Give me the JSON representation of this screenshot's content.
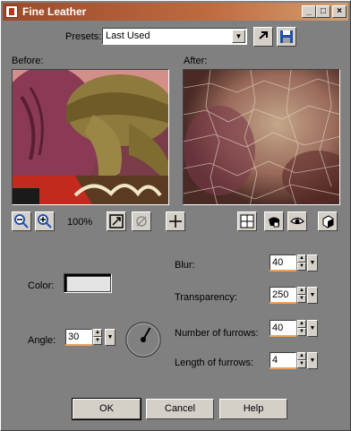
{
  "window": {
    "title": "Fine Leather",
    "minimize_glyph": "_",
    "maximize_glyph": "□",
    "close_glyph": "×"
  },
  "presets": {
    "label": "Presets:",
    "value": "Last Used"
  },
  "preview": {
    "before_label": "Before:",
    "after_label": "After:",
    "zoom_level": "100%"
  },
  "settings": {
    "color_label": "Color:",
    "color_value": "#e4e4e4",
    "angle_label": "Angle:",
    "angle_value": "30",
    "blur_label": "Blur:",
    "blur_value": "40",
    "transparency_label": "Transparency:",
    "transparency_value": "250",
    "furrows_label": "Number of furrows:",
    "furrows_value": "40",
    "furrow_length_label": "Length of furrows:",
    "furrow_length_value": "4"
  },
  "buttons": {
    "ok": "OK",
    "cancel": "Cancel",
    "help": "Help"
  },
  "colors": {
    "title_start": "#9a4a2a",
    "title_end": "#d4a070",
    "dialog_bg": "#808080",
    "control_face": "#d4d0c8",
    "field_accent": "#e8a060"
  }
}
